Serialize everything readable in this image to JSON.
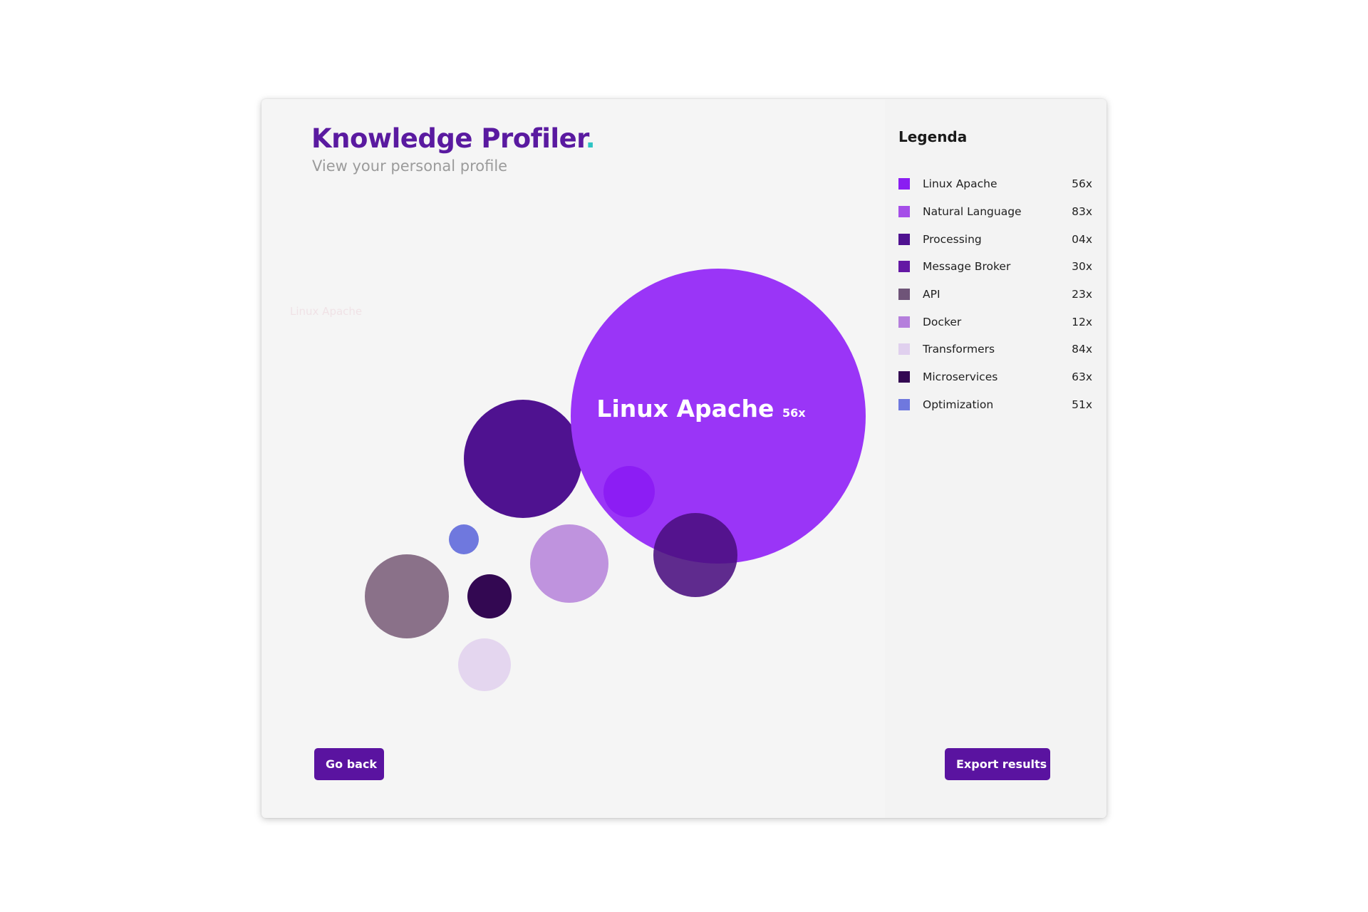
{
  "header": {
    "title": "Knowledge Profiler",
    "title_dot": ".",
    "subtitle": "View your personal profile"
  },
  "faint_label": "Linux Apache",
  "legend": {
    "title": "Legenda",
    "items": [
      {
        "name": "Linux Apache",
        "count": "56x",
        "color": "#8a1ef2"
      },
      {
        "name": "Natural Language",
        "count": "83x",
        "color": "#a54ee8"
      },
      {
        "name": "Processing",
        "count": "04x",
        "color": "#4f1290"
      },
      {
        "name": "Message Broker",
        "count": "30x",
        "color": "#6418a4"
      },
      {
        "name": "API",
        "count": "23x",
        "color": "#6f5478"
      },
      {
        "name": "Docker",
        "count": "12x",
        "color": "#b57fdc"
      },
      {
        "name": "Transformers",
        "count": "84x",
        "color": "#e0d0ee"
      },
      {
        "name": "Microservices",
        "count": "63x",
        "color": "#330852"
      },
      {
        "name": "Optimization",
        "count": "51x",
        "color": "#6f78de"
      }
    ]
  },
  "chart_data": {
    "type": "bubble",
    "highlight": {
      "label": "Linux Apache",
      "count": "56x"
    }
  },
  "buttons": {
    "back_label": "Go back",
    "export_label": "Export results"
  },
  "colors": {
    "brand": "#5a1aa0",
    "accent_dot": "#2ec4c4",
    "button": "#5a13a0"
  }
}
